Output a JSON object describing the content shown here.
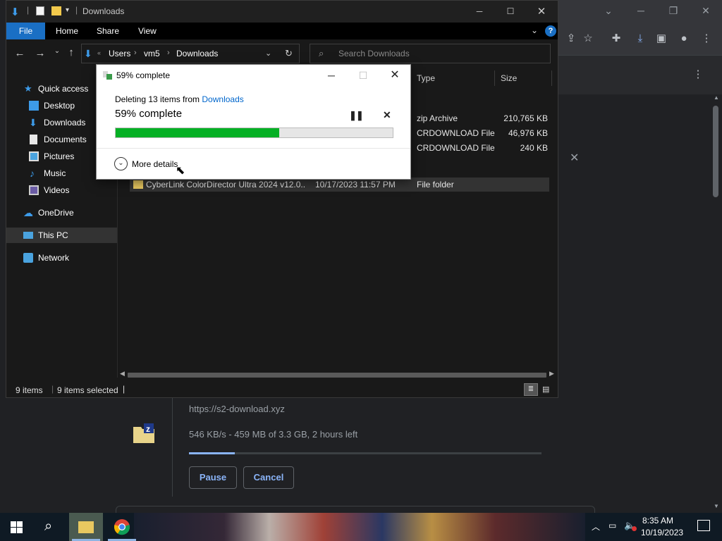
{
  "chrome": {
    "download": {
      "url": "https://s2-download.xyz",
      "status": "546 KB/s - 459 MB of 3.3 GB, 2 hours left",
      "progress": 0.13,
      "pause_label": "Pause",
      "cancel_label": "Cancel",
      "icon": "zip-file-icon"
    },
    "toolbar_icons": [
      "share-icon",
      "star-icon",
      "extensions-icon",
      "downloads-icon",
      "sidepanel-icon",
      "profile-icon",
      "menu-icon"
    ]
  },
  "explorer": {
    "title": "Downloads",
    "ribbon": {
      "file": "File",
      "home": "Home",
      "share": "Share",
      "view": "View"
    },
    "address": {
      "crumbs": [
        "Users",
        "vm5",
        "Downloads"
      ]
    },
    "search": {
      "placeholder": "Search Downloads"
    },
    "nav": {
      "quick_access": "Quick access",
      "desktop": "Desktop",
      "downloads": "Downloads",
      "documents": "Documents",
      "pictures": "Pictures",
      "music": "Music",
      "videos": "Videos",
      "onedrive": "OneDrive",
      "this_pc": "This PC",
      "network": "Network"
    },
    "columns": {
      "type": "Type",
      "size": "Size"
    },
    "rows": [
      {
        "type": "zip Archive",
        "size": "210,765 KB"
      },
      {
        "type": "CRDOWNLOAD File",
        "size": "46,976 KB"
      },
      {
        "type": "CRDOWNLOAD File",
        "size": "240 KB"
      }
    ],
    "selected_row": {
      "name": "CyberLink ColorDirector Ultra 2024 v12.0....",
      "date": "10/17/2023 11:57 PM",
      "type": "File folder"
    },
    "status": {
      "count": "9 items",
      "selected": "9 items selected"
    }
  },
  "dialog": {
    "title": "59% complete",
    "desc_prefix": "Deleting 13 items from ",
    "desc_link": "Downloads",
    "percent_text": "59% complete",
    "progress": 0.59,
    "more_details": "More details"
  },
  "taskbar": {
    "time": "8:35 AM",
    "date": "10/19/2023"
  }
}
